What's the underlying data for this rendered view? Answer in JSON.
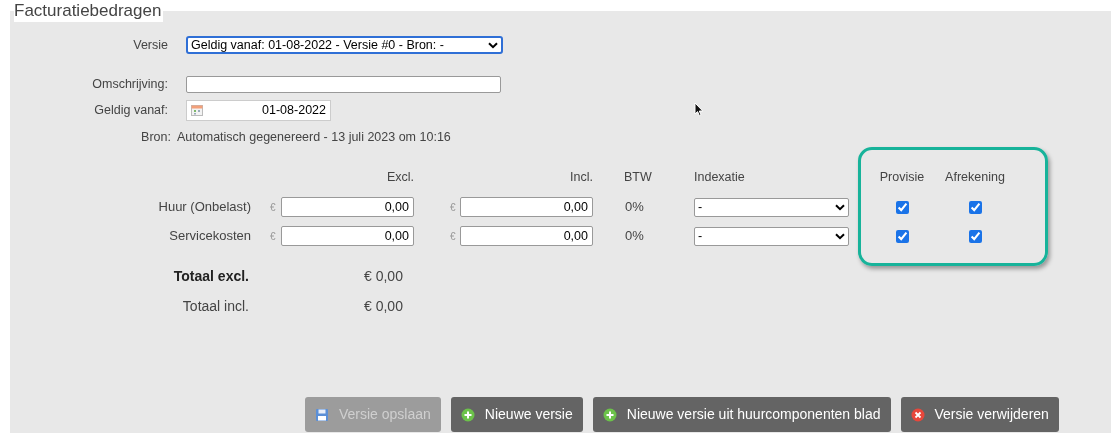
{
  "legend": "Facturatiebedragen",
  "version": {
    "label": "Versie",
    "value": "Geldig vanaf: 01-08-2022 - Versie #0 - Bron: -"
  },
  "description": {
    "label": "Omschrijving:"
  },
  "valid_from": {
    "label": "Geldig vanaf:",
    "value": "01-08-2022"
  },
  "source": {
    "label": "Bron:",
    "value": "Automatisch gegenereerd - 13 juli 2023 om 10:16"
  },
  "columns": [
    {
      "label": "Excl."
    },
    {
      "label": "Incl."
    },
    {
      "label": "BTW"
    },
    {
      "label": "Indexatie"
    },
    {
      "label": "Provisie"
    },
    {
      "label": "Afrekening"
    }
  ],
  "rows": [
    {
      "label": "Huur (Onbelast)",
      "currency_excl": "€",
      "excl": "0,00",
      "currency_incl": "€",
      "incl": "0,00",
      "btw": "0%",
      "indexatie": "-",
      "provisie": true,
      "afrekening": true
    },
    {
      "label": "Servicekosten",
      "currency_excl": "€",
      "excl": "0,00",
      "currency_incl": "€",
      "incl": "0,00",
      "btw": "0%",
      "indexatie": "-",
      "provisie": true,
      "afrekening": true
    }
  ],
  "totals": [
    {
      "label": "Totaal excl.",
      "value": "€ 0,00",
      "bold": true
    },
    {
      "label": "Totaal incl.",
      "value": "€ 0,00",
      "bold": false
    }
  ],
  "buttons": [
    {
      "label": "Versie opslaan",
      "kind": "save",
      "disabled": true
    },
    {
      "label": "Nieuwe versie",
      "kind": "add",
      "disabled": false
    },
    {
      "label": "Nieuwe versie uit huurcomponenten blad",
      "kind": "add",
      "disabled": false
    },
    {
      "label": "Versie verwijderen",
      "kind": "delete",
      "disabled": false
    }
  ]
}
